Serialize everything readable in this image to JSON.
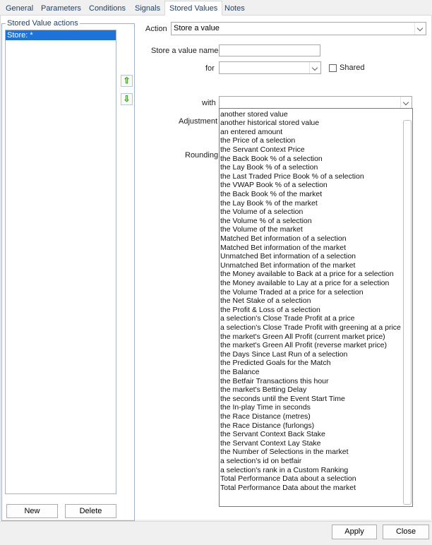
{
  "tabs": [
    {
      "label": "General"
    },
    {
      "label": "Parameters"
    },
    {
      "label": "Conditions"
    },
    {
      "label": "Signals"
    },
    {
      "label": "Stored Values",
      "active": true
    },
    {
      "label": "Notes"
    }
  ],
  "group": {
    "title": "Stored Value actions",
    "list_items": [
      "Store: *"
    ],
    "new_label": "New",
    "delete_label": "Delete"
  },
  "form": {
    "action_label": "Action",
    "action_value": "Store a value",
    "store_named_label": "Store a value named",
    "store_named_value": "",
    "for_label": "for",
    "for_value": "",
    "shared_label": "Shared",
    "with_label": "with",
    "with_value": "",
    "adjustment_label": "Adjustment",
    "rounding_label": "Rounding"
  },
  "dropdown_options": [
    "another stored value",
    "another historical stored value",
    "an entered amount",
    "the Price of a selection",
    "the Servant Context Price",
    "the Back Book % of a selection",
    "the Lay Book % of a selection",
    "the Last Traded Price Book % of a selection",
    "the VWAP Book % of a selection",
    "the Back Book % of the market",
    "the Lay Book % of the market",
    "the Volume of a selection",
    "the Volume % of a selection",
    "the Volume of the market",
    "Matched Bet information of a selection",
    "Matched Bet information of the market",
    "Unmatched Bet information of a selection",
    "Unmatched Bet information of the market",
    "the Money available to Back at a price for a selection",
    "the Money available to Lay at a price for a selection",
    "the Volume Traded at a price for a selection",
    "the Net Stake of a selection",
    "the Profit & Loss of a selection",
    "a selection's Close Trade Profit at a price",
    "a selection's Close Trade Profit with greening at a price",
    "the market's Green All Profit (current market price)",
    "the market's Green All Profit (reverse market price)",
    "the Days Since Last Run of a selection",
    "the Predicted Goals for the Match",
    "the Balance",
    "the Betfair Transactions this hour",
    "the market's Betting Delay",
    "the seconds until the Event Start Time",
    "the In-play Time in seconds",
    "the Race Distance (metres)",
    "the Race Distance (furlongs)",
    "the Servant Context Back Stake",
    "the Servant Context Lay Stake",
    "the Number of Selections in the market",
    "a selection's id on betfair",
    "a selection's rank in a Custom Ranking",
    "Total Performance Data about a selection",
    "Total Performance Data about the market"
  ],
  "footer": {
    "apply_label": "Apply",
    "close_label": "Close"
  },
  "icons": {
    "move_up": "green-up-arrow-icon",
    "move_down": "green-down-arrow-icon"
  }
}
